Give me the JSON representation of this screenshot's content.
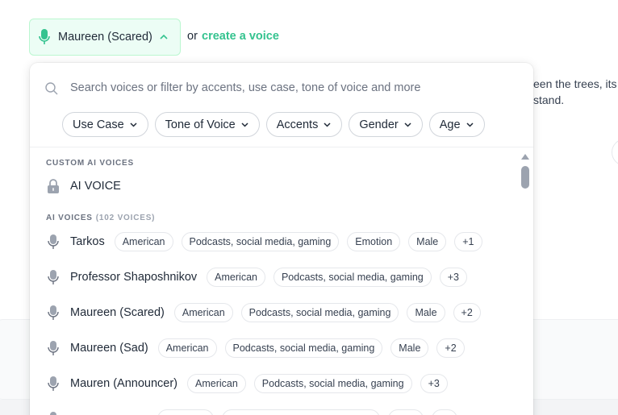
{
  "background": {
    "text_line1": "een the trees, its",
    "text_line2": "stand."
  },
  "selector": {
    "selected_voice": "Maureen (Scared)",
    "or_text": "or",
    "create_link": "create a voice",
    "accent_color": "#34c38f"
  },
  "dropdown": {
    "search_placeholder": "Search voices or filter by accents, use case, tone of voice and more",
    "filters": [
      "Use Case",
      "Tone of Voice",
      "Accents",
      "Gender",
      "Age"
    ],
    "custom_section": "CUSTOM AI VOICES",
    "custom_voice": "AI VOICE",
    "ai_section": "AI VOICES",
    "ai_count": "(102 VOICES)",
    "voices": [
      {
        "name": "Tarkos",
        "tags": [
          "American",
          "Podcasts, social media, gaming",
          "Emotion",
          "Male",
          "+1"
        ]
      },
      {
        "name": "Professor Shaposhnikov",
        "tags": [
          "American",
          "Podcasts, social media, gaming",
          "+3"
        ]
      },
      {
        "name": "Maureen (Scared)",
        "tags": [
          "American",
          "Podcasts, social media, gaming",
          "Male",
          "+2"
        ]
      },
      {
        "name": "Maureen (Sad)",
        "tags": [
          "American",
          "Podcasts, social media, gaming",
          "Male",
          "+2"
        ]
      },
      {
        "name": "Mauren (Announcer)",
        "tags": [
          "American",
          "Podcasts, social media, gaming",
          "+3"
        ]
      }
    ]
  }
}
